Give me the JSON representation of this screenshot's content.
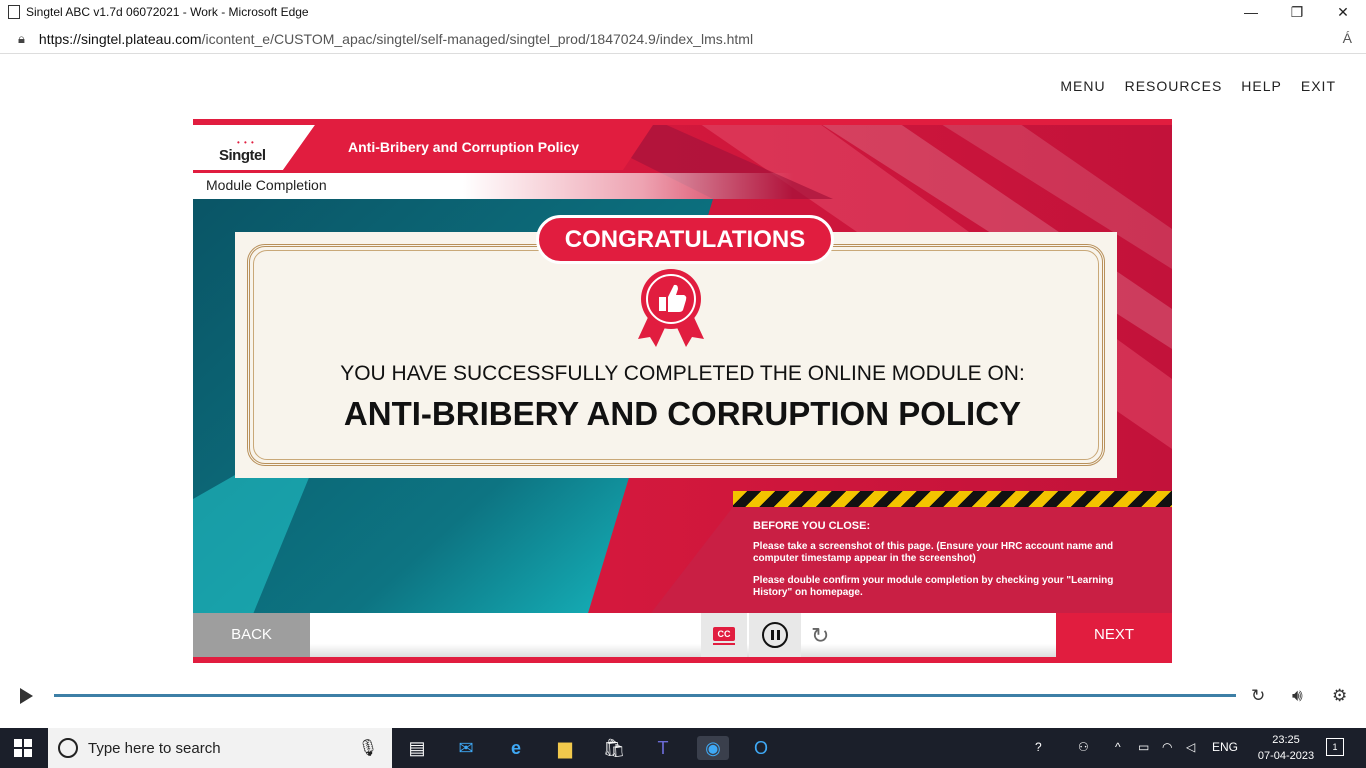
{
  "browser": {
    "window_title": "Singtel ABC v1.7d 06072021 - Work - Microsoft Edge",
    "url_host": "https://singtel.plateau.com",
    "url_path": "/icontent_e/CUSTOM_apac/singtel/self-managed/singtel_prod/1847024.9/index_lms.html",
    "min": "—",
    "max": "❐",
    "close": "✕",
    "read_aloud": "Á"
  },
  "topnav": [
    "MENU",
    "RESOURCES",
    "HELP",
    "EXIT"
  ],
  "course": {
    "logo": "Singtel",
    "title": "Anti-Bribery and Corruption Policy",
    "module_label": "Module Completion",
    "congrats": "CONGRATULATIONS",
    "line1": "YOU HAVE SUCCESSFULLY COMPLETED THE ONLINE MODULE ON:",
    "line2": "ANTI-BRIBERY AND CORRUPTION POLICY",
    "notice": {
      "title": "BEFORE YOU CLOSE:",
      "p1": "Please take a screenshot of this page. (Ensure your HRC account name and computer timestamp appear in the screenshot)",
      "p2": "Please double confirm your module completion by checking your \"Learning History\" on homepage."
    },
    "back": "BACK",
    "next": "NEXT",
    "cc": "CC",
    "colors": {
      "accent": "#e11d3f",
      "teal": "#0b6b78",
      "gold": "#b8905a"
    }
  },
  "taskbar": {
    "search_placeholder": "Type here to search",
    "lang": "ENG",
    "time": "23:25",
    "date": "07-04-2023",
    "notifications": "1"
  }
}
